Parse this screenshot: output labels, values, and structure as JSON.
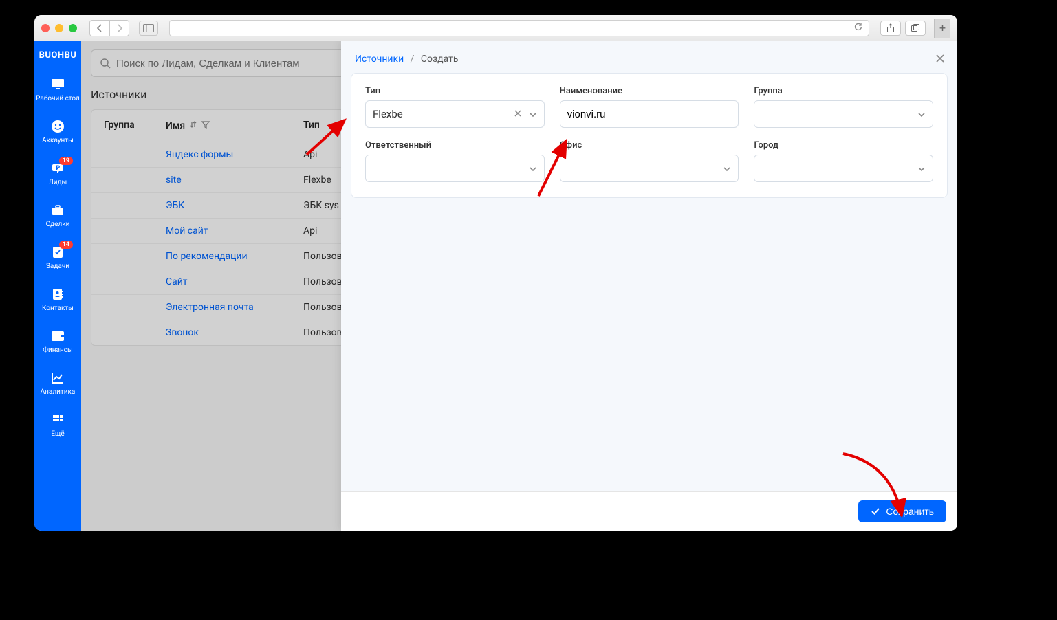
{
  "browser": {
    "logo": "BUOHBU"
  },
  "sidebar": {
    "items": [
      {
        "label": "Рабочий стол",
        "icon": "desktop"
      },
      {
        "label": "Аккаунты",
        "icon": "smile"
      },
      {
        "label": "Лиды",
        "icon": "leads",
        "badge": "19"
      },
      {
        "label": "Сделки",
        "icon": "briefcase"
      },
      {
        "label": "Задачи",
        "icon": "tasks",
        "badge": "14"
      },
      {
        "label": "Контакты",
        "icon": "contacts"
      },
      {
        "label": "Финансы",
        "icon": "wallet"
      },
      {
        "label": "Аналитика",
        "icon": "chart"
      },
      {
        "label": "Ещё",
        "icon": "more"
      }
    ]
  },
  "search": {
    "placeholder": "Поиск по Лидам, Сделкам и Клиентам"
  },
  "page": {
    "title": "Источники"
  },
  "table": {
    "headers": {
      "group": "Группа",
      "name": "Имя",
      "type": "Тип"
    },
    "rows": [
      {
        "name": "Яндекс формы",
        "type": "Api"
      },
      {
        "name": "site",
        "type": "Flexbe"
      },
      {
        "name": "ЭБК",
        "type": "ЭБК sys"
      },
      {
        "name": "Мой сайт",
        "type": "Api"
      },
      {
        "name": "По рекомендации",
        "type": "Пользов"
      },
      {
        "name": "Сайт",
        "type": "Пользов"
      },
      {
        "name": "Электронная почта",
        "type": "Пользов"
      },
      {
        "name": "Звонок",
        "type": "Пользов"
      }
    ]
  },
  "panel": {
    "breadcrumb": {
      "root": "Источники",
      "current": "Создать"
    },
    "fields": {
      "type": {
        "label": "Тип",
        "value": "Flexbe"
      },
      "name": {
        "label": "Наименование",
        "value": "vionvi.ru"
      },
      "group": {
        "label": "Группа",
        "value": ""
      },
      "responsible": {
        "label": "Ответственный",
        "value": ""
      },
      "office": {
        "label": "Офис",
        "value": ""
      },
      "city": {
        "label": "Город",
        "value": ""
      }
    },
    "save": "Сохранить"
  }
}
